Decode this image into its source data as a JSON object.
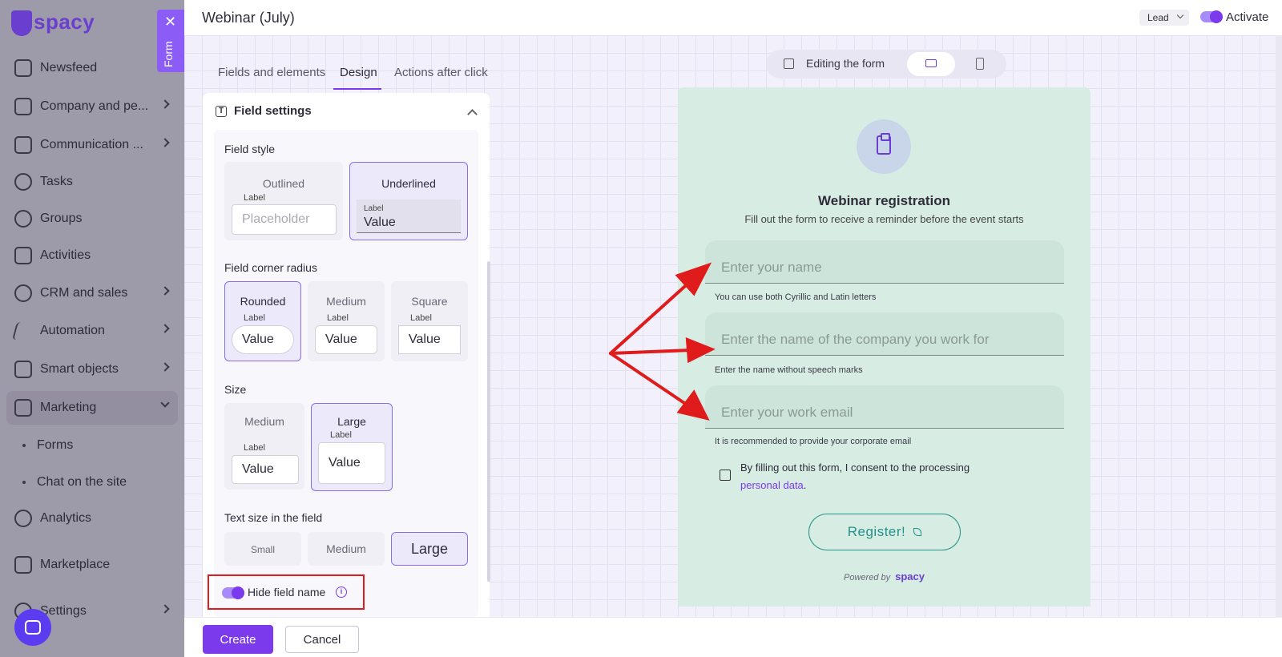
{
  "app": {
    "logo_text": "spacy"
  },
  "sidebar": {
    "items": [
      {
        "label": "Newsfeed",
        "icon": "home-icon"
      },
      {
        "label": "Company and pe...",
        "icon": "building-icon"
      },
      {
        "label": "Communication ...",
        "icon": "chat-icon"
      },
      {
        "label": "Tasks",
        "icon": "check-circle-icon"
      },
      {
        "label": "Groups",
        "icon": "users-icon"
      },
      {
        "label": "Activities",
        "icon": "calendar-icon"
      },
      {
        "label": "CRM and sales",
        "icon": "coins-icon"
      },
      {
        "label": "Automation",
        "icon": "lightning-icon"
      },
      {
        "label": "Smart objects",
        "icon": "smart-object-icon"
      },
      {
        "label": "Marketing",
        "icon": "marketing-icon"
      },
      {
        "label": "Analytics",
        "icon": "chart-icon"
      },
      {
        "label": "Marketplace",
        "icon": "store-icon"
      },
      {
        "label": "Settings",
        "icon": "gear-icon"
      }
    ],
    "sub_items": [
      "Forms",
      "Chat on the site"
    ]
  },
  "form_tab": {
    "label": "Form"
  },
  "header": {
    "title": "Webinar (July)",
    "lead_select": "Lead",
    "activate_label": "Activate"
  },
  "tabs": [
    "Fields and elements",
    "Design",
    "Actions after click"
  ],
  "settings": {
    "panel_title": "Field settings",
    "field_style": {
      "title": "Field style",
      "outlined": {
        "title": "Outlined",
        "label": "Label",
        "placeholder": "Placeholder"
      },
      "underlined": {
        "title": "Underlined",
        "label": "Label",
        "value": "Value"
      }
    },
    "corner_radius": {
      "title": "Field corner radius",
      "options": [
        {
          "title": "Rounded",
          "label": "Label",
          "value": "Value"
        },
        {
          "title": "Medium",
          "label": "Label",
          "value": "Value"
        },
        {
          "title": "Square",
          "label": "Label",
          "value": "Value"
        }
      ]
    },
    "size": {
      "title": "Size",
      "options": [
        {
          "title": "Medium",
          "label": "Label",
          "value": "Value"
        },
        {
          "title": "Large",
          "label": "Label",
          "value": "Value"
        }
      ]
    },
    "text_size": {
      "title": "Text size in the field",
      "options": [
        "Small",
        "Medium",
        "Large"
      ]
    },
    "hide_field_name": {
      "label": "Hide field name",
      "enabled": true
    }
  },
  "actions": {
    "create": "Create",
    "cancel": "Cancel"
  },
  "editor_toolbar": {
    "editing_label": "Editing the form"
  },
  "preview": {
    "title": "Webinar registration",
    "subtitle": "Fill out the form to receive a reminder before the event starts",
    "fields": [
      {
        "placeholder": "Enter your name",
        "hint": "You can use both Cyrillic and Latin letters"
      },
      {
        "placeholder": "Enter the name of the company you work for",
        "hint": "Enter the name without speech marks"
      },
      {
        "placeholder": "Enter your work email",
        "hint": "It is recommended to provide your corporate email"
      }
    ],
    "consent_text": "By filling out this form, I consent to the processing",
    "consent_link": "personal data",
    "consent_end": ".",
    "register_button": "Register!",
    "powered_by": "Powered by",
    "powered_logo": "spacy"
  },
  "colors": {
    "accent": "#7c3aed",
    "annotation": "#e01b1b",
    "form_bg": "#d7ede4",
    "register": "#23928a"
  }
}
